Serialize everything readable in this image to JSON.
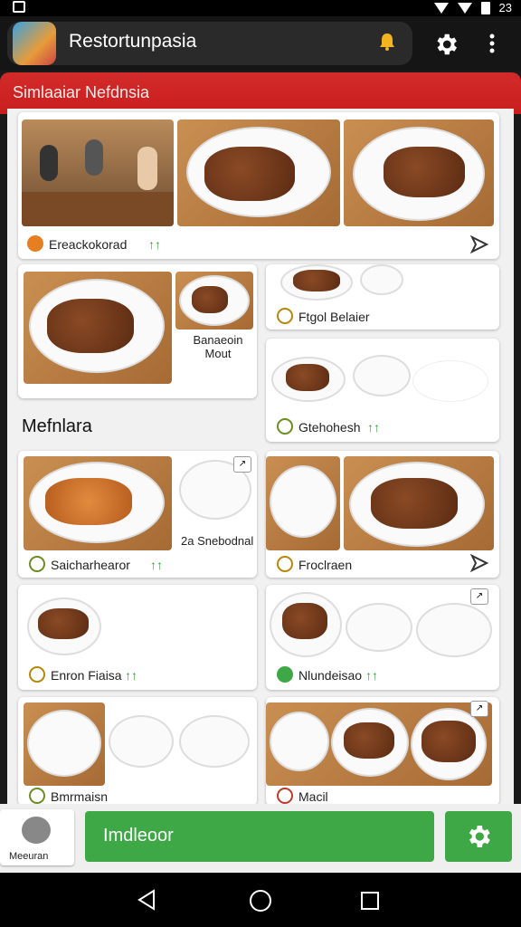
{
  "app": {
    "title": "Restortunpasia",
    "banner": "Simlaaiar Nefdnsia"
  },
  "status": {
    "time": "23"
  },
  "cards": [
    {
      "caption": "Ereackokorad",
      "badge": "↑↑"
    },
    {
      "caption": "Banaeoin Mout"
    },
    {
      "caption": "Ftgol Belaier"
    },
    {
      "caption": "Gtehohesh",
      "badge": "↑↑"
    },
    {
      "caption": "Saicharhearor",
      "badge": "↑↑"
    },
    {
      "caption": "2a Snebodnal"
    },
    {
      "caption": "Froclraen"
    },
    {
      "caption": "Enron Fiaisa",
      "badge": "↑↑"
    },
    {
      "caption": "Nlundeisao",
      "badge": "↑↑"
    },
    {
      "caption": "Bmrmaisn"
    },
    {
      "caption": "Macil"
    }
  ],
  "section_title": "Mefnlara",
  "bottom": {
    "avatar_label": "Meeuran",
    "primary_label": "Imdleoor"
  },
  "colors": {
    "banner": "#c81e1e",
    "primary": "#3fa846"
  },
  "icons": [
    "bell-icon",
    "gear-icon",
    "more-icon",
    "share-icon",
    "back-icon",
    "home-icon",
    "recents-icon"
  ]
}
